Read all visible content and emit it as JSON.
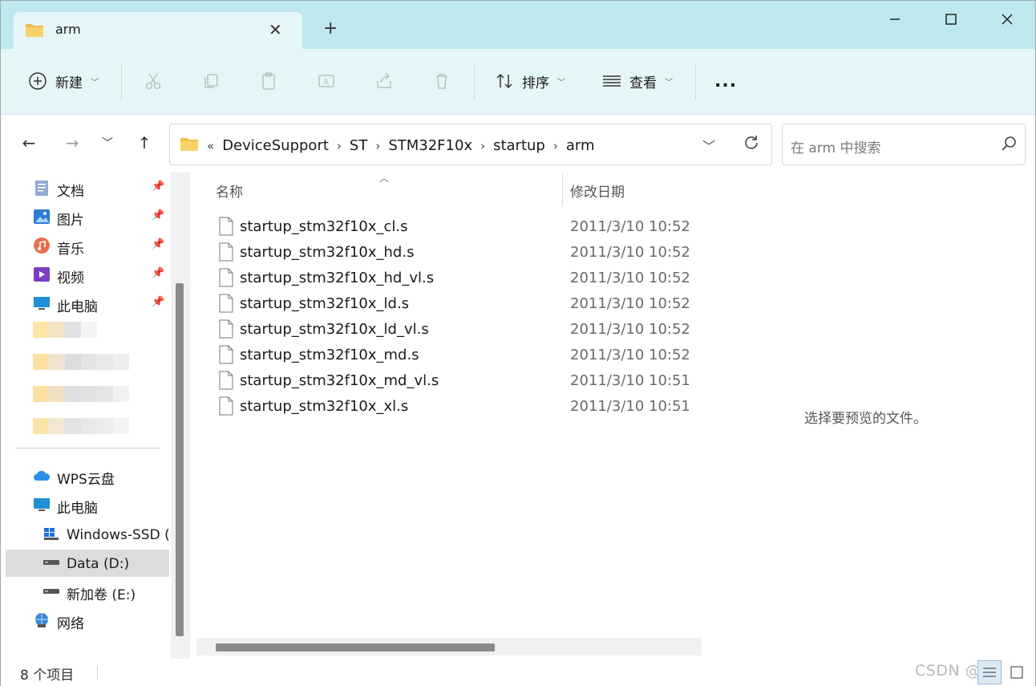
{
  "tab": {
    "title": "arm",
    "new_tab": "+"
  },
  "toolbar": {
    "new_label": "新建",
    "sort_label": "排序",
    "view_label": "查看",
    "more_label": "..."
  },
  "breadcrumb": {
    "overflow": "«",
    "items": [
      "DeviceSupport",
      "ST",
      "STM32F10x",
      "startup",
      "arm"
    ]
  },
  "search": {
    "placeholder": "在 arm 中搜索"
  },
  "sidebar": {
    "quick": [
      {
        "label": "文档",
        "icon": "document-icon"
      },
      {
        "label": "图片",
        "icon": "picture-icon"
      },
      {
        "label": "音乐",
        "icon": "music-icon"
      },
      {
        "label": "视频",
        "icon": "video-icon"
      },
      {
        "label": "此电脑",
        "icon": "computer-icon"
      }
    ],
    "locations": [
      {
        "label": "WPS云盘",
        "icon": "cloud-icon"
      },
      {
        "label": "此电脑",
        "icon": "computer-icon"
      },
      {
        "label": "Windows-SSD (",
        "icon": "windows-drive-icon"
      },
      {
        "label": "Data (D:)",
        "icon": "drive-icon",
        "selected": true
      },
      {
        "label": "新加卷 (E:)",
        "icon": "drive-icon"
      },
      {
        "label": "网络",
        "icon": "network-icon"
      }
    ]
  },
  "columns": {
    "name": "名称",
    "modified": "修改日期"
  },
  "files": [
    {
      "name": "startup_stm32f10x_cl.s",
      "modified": "2011/3/10 10:52"
    },
    {
      "name": "startup_stm32f10x_hd.s",
      "modified": "2011/3/10 10:52"
    },
    {
      "name": "startup_stm32f10x_hd_vl.s",
      "modified": "2011/3/10 10:52"
    },
    {
      "name": "startup_stm32f10x_ld.s",
      "modified": "2011/3/10 10:52"
    },
    {
      "name": "startup_stm32f10x_ld_vl.s",
      "modified": "2011/3/10 10:52"
    },
    {
      "name": "startup_stm32f10x_md.s",
      "modified": "2011/3/10 10:52"
    },
    {
      "name": "startup_stm32f10x_md_vl.s",
      "modified": "2011/3/10 10:51"
    },
    {
      "name": "startup_stm32f10x_xl.s",
      "modified": "2011/3/10 10:51"
    }
  ],
  "preview": {
    "message": "选择要预览的文件。"
  },
  "status": {
    "item_count": "8 个项目"
  },
  "watermark": "CSDN @",
  "colors": {
    "titlebar": "#bfe8ee",
    "toolbar": "#e6f6f8",
    "folder": "#f2c04a",
    "selected": "#dcdcdc"
  }
}
